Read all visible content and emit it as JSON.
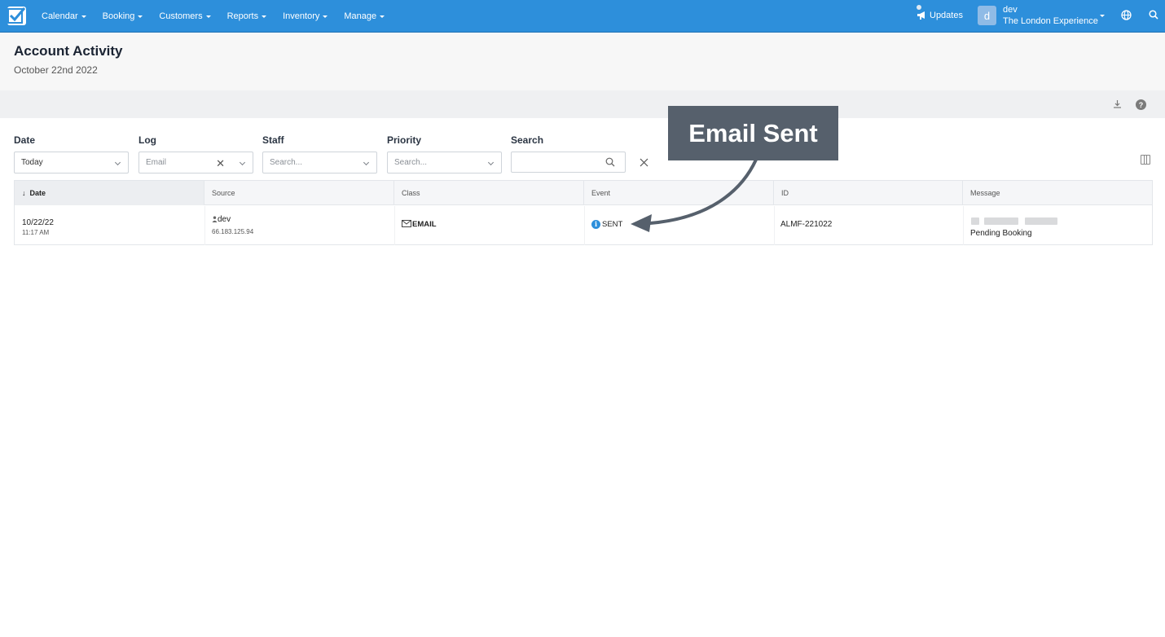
{
  "nav": {
    "items": [
      "Calendar",
      "Booking",
      "Customers",
      "Reports",
      "Inventory",
      "Manage"
    ],
    "updates_label": "Updates",
    "avatar_initial": "d",
    "user_name": "dev",
    "user_org": "The London Experience"
  },
  "header": {
    "title": "Account Activity",
    "subtitle": "October 22nd 2022"
  },
  "filters": {
    "date_label": "Date",
    "date_value": "Today",
    "log_label": "Log",
    "log_value": "Email",
    "staff_label": "Staff",
    "staff_placeholder": "Search...",
    "priority_label": "Priority",
    "priority_placeholder": "Search...",
    "search_label": "Search",
    "search_value": ""
  },
  "table": {
    "columns": [
      "Date",
      "Source",
      "Class",
      "Event",
      "ID",
      "Message"
    ],
    "rows": [
      {
        "date": "10/22/22",
        "time": "11:17 AM",
        "source_user": "dev",
        "source_ip": "66.183.125.94",
        "class": "EMAIL",
        "event": "SENT",
        "id": "ALMF-221022",
        "message": "Pending Booking"
      }
    ]
  },
  "callout": {
    "text": "Email Sent"
  },
  "colors": {
    "navbar": "#2d8fdb",
    "callout": "#56606c",
    "info": "#2d8fdb"
  }
}
